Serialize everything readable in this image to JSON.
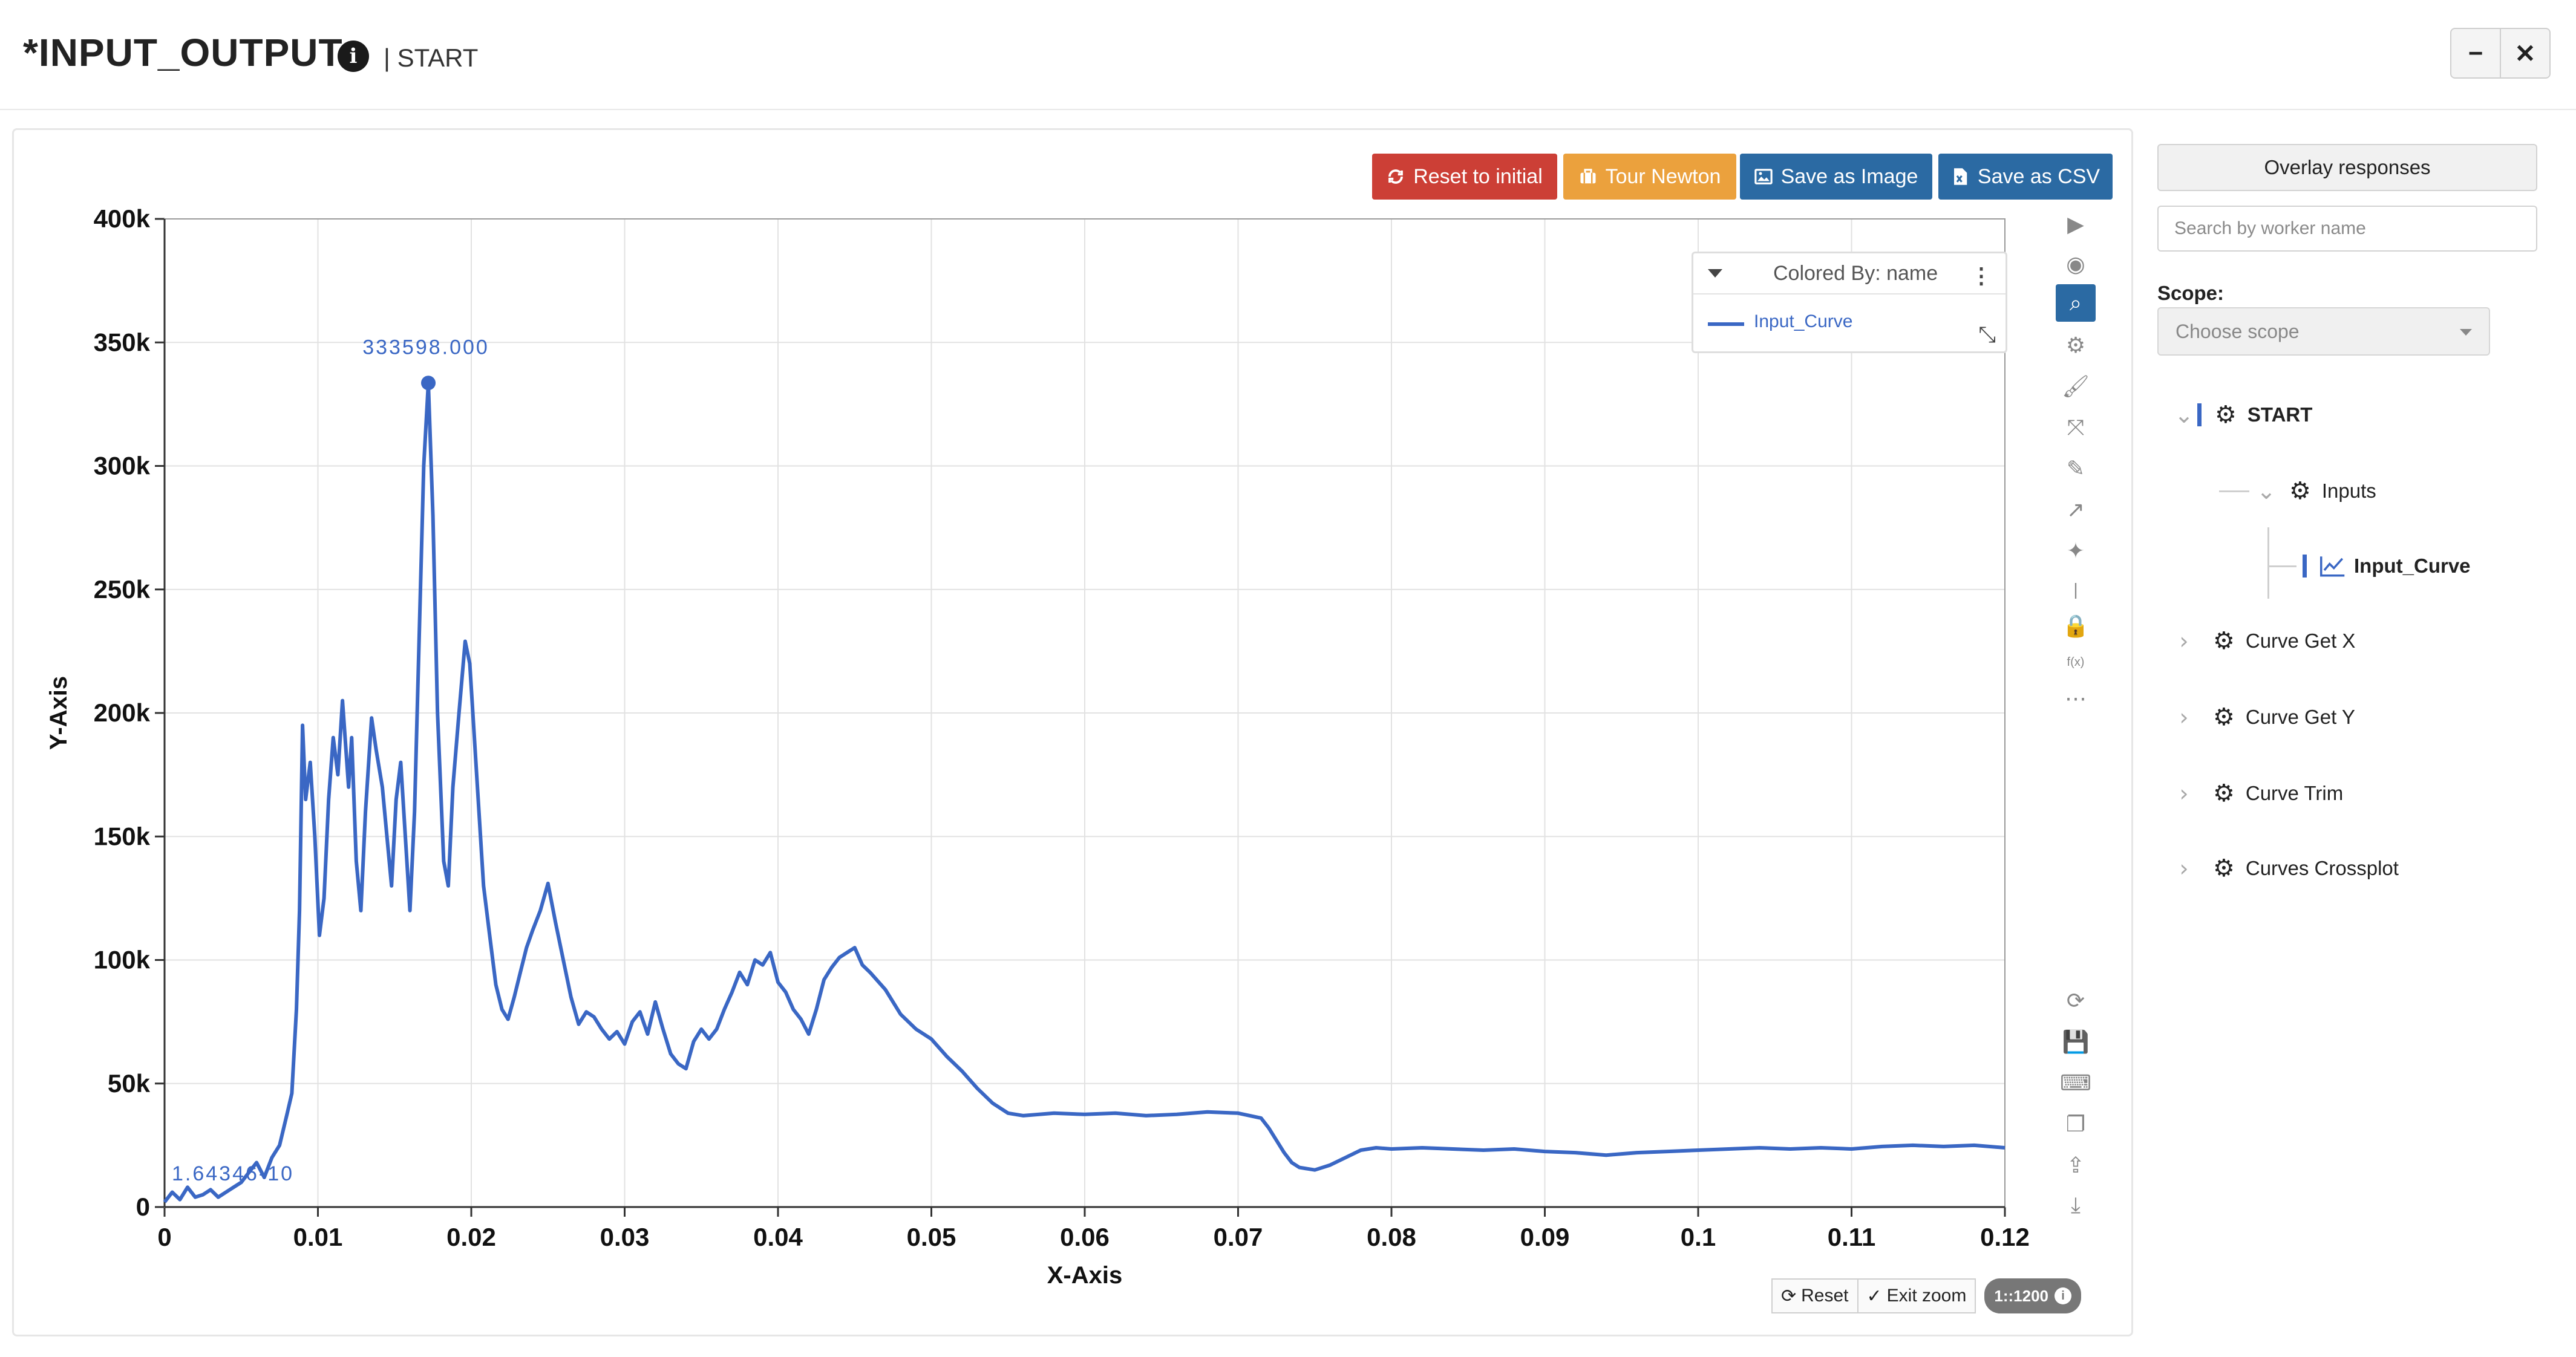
{
  "header": {
    "title": "*INPUT_OUTPUT",
    "separator_text": "| START",
    "minimize_glyph": "−",
    "close_glyph": "✕"
  },
  "toolbar": {
    "reset_initial_label": "Reset to initial",
    "tour_label": "Tour Newton",
    "save_image_label": "Save as Image",
    "save_csv_label": "Save as CSV"
  },
  "legend": {
    "title": "Colored By: name",
    "series_name": "Input_Curve",
    "series_color": "#3a67c4"
  },
  "chart_tools": [
    "play-icon",
    "eye-icon",
    "zoom-icon",
    "gear-icon",
    "brush-icon",
    "expand-icon",
    "pencil-icon",
    "arrow-icon",
    "magic-wand-icon",
    "separator-icon",
    "lock-icon",
    "function-icon",
    "more-icon",
    "refresh-icon",
    "save-icon",
    "keyboard-icon",
    "copy-icon",
    "upload-icon",
    "download-icon"
  ],
  "zoom_bar": {
    "reset_label": "Reset",
    "exit_zoom_label": "Exit zoom",
    "scale_label": "1::1200"
  },
  "sidebar": {
    "overlay_label": "Overlay responses",
    "search_placeholder": "Search by worker name",
    "scope_label": "Scope:",
    "scope_placeholder": "Choose scope",
    "tree": {
      "start": "START",
      "inputs": "Inputs",
      "input_curve": "Input_Curve",
      "curve_get_x": "Curve Get X",
      "curve_get_y": "Curve Get Y",
      "curve_trim": "Curve Trim",
      "curves_crossplot": "Curves Crossplot"
    }
  },
  "chart_data": {
    "type": "line",
    "xlabel": "X-Axis",
    "ylabel": "Y-Axis",
    "xlim": [
      0,
      0.12
    ],
    "ylim": [
      0,
      400000
    ],
    "x_ticks": [
      "0",
      "0.01",
      "0.02",
      "0.03",
      "0.04",
      "0.05",
      "0.06",
      "0.07",
      "0.08",
      "0.09",
      "0.1",
      "0.11",
      "0.12"
    ],
    "y_ticks": [
      "0",
      "50k",
      "100k",
      "150k",
      "200k",
      "250k",
      "300k",
      "350k",
      "400k"
    ],
    "grid": true,
    "legend_position": "top-right",
    "annotations": {
      "max_label": "333598.000",
      "max_point": [
        0.0172,
        333598
      ],
      "min_label": "1.64346-10"
    },
    "series": [
      {
        "name": "Input_Curve",
        "color": "#3a67c4",
        "x": [
          0,
          0.0005,
          0.001,
          0.0015,
          0.002,
          0.0025,
          0.003,
          0.0035,
          0.004,
          0.0045,
          0.005,
          0.0055,
          0.006,
          0.0065,
          0.007,
          0.0075,
          0.008,
          0.0083,
          0.0086,
          0.0088,
          0.009,
          0.0092,
          0.0095,
          0.0098,
          0.0101,
          0.0104,
          0.0107,
          0.011,
          0.0113,
          0.0116,
          0.012,
          0.0122,
          0.0125,
          0.0128,
          0.0131,
          0.0135,
          0.0138,
          0.0142,
          0.0145,
          0.0148,
          0.0151,
          0.0154,
          0.0157,
          0.016,
          0.0163,
          0.0166,
          0.0169,
          0.0172,
          0.0175,
          0.0178,
          0.0182,
          0.0185,
          0.0188,
          0.0192,
          0.0196,
          0.0199,
          0.0202,
          0.0205,
          0.0208,
          0.0212,
          0.0216,
          0.022,
          0.0224,
          0.0228,
          0.0232,
          0.0236,
          0.024,
          0.0245,
          0.025,
          0.0255,
          0.026,
          0.0265,
          0.027,
          0.0275,
          0.028,
          0.0285,
          0.029,
          0.0295,
          0.03,
          0.0305,
          0.031,
          0.0315,
          0.032,
          0.0325,
          0.033,
          0.0335,
          0.034,
          0.0345,
          0.035,
          0.0355,
          0.036,
          0.0365,
          0.037,
          0.0375,
          0.038,
          0.0385,
          0.039,
          0.0395,
          0.04,
          0.0405,
          0.041,
          0.0415,
          0.042,
          0.0425,
          0.043,
          0.0435,
          0.044,
          0.0445,
          0.045,
          0.0455,
          0.046,
          0.047,
          0.048,
          0.049,
          0.05,
          0.051,
          0.052,
          0.053,
          0.054,
          0.055,
          0.056,
          0.058,
          0.06,
          0.062,
          0.064,
          0.066,
          0.068,
          0.07,
          0.0715,
          0.072,
          0.0725,
          0.073,
          0.0735,
          0.074,
          0.075,
          0.076,
          0.077,
          0.078,
          0.079,
          0.08,
          0.082,
          0.084,
          0.086,
          0.088,
          0.09,
          0.092,
          0.094,
          0.096,
          0.098,
          0.1,
          0.102,
          0.104,
          0.106,
          0.108,
          0.11,
          0.112,
          0.114,
          0.116,
          0.118,
          0.12
        ],
        "values": [
          2000,
          6000,
          3000,
          8000,
          4000,
          5000,
          7000,
          4000,
          6000,
          8000,
          10000,
          14000,
          18000,
          12000,
          20000,
          25000,
          38000,
          46000,
          80000,
          120000,
          195000,
          165000,
          180000,
          150000,
          110000,
          125000,
          165000,
          190000,
          175000,
          205000,
          170000,
          190000,
          140000,
          120000,
          160000,
          198000,
          185000,
          170000,
          150000,
          130000,
          165000,
          180000,
          150000,
          120000,
          160000,
          230000,
          300000,
          333598,
          280000,
          200000,
          140000,
          130000,
          170000,
          200000,
          229000,
          220000,
          190000,
          160000,
          130000,
          110000,
          90000,
          80000,
          76000,
          85000,
          95000,
          105000,
          112000,
          120000,
          131000,
          115000,
          100000,
          85000,
          74000,
          79000,
          77000,
          72000,
          68000,
          71000,
          66000,
          75000,
          79000,
          70000,
          83000,
          72000,
          62000,
          58000,
          56000,
          67000,
          72000,
          68000,
          72000,
          80000,
          87000,
          95000,
          90000,
          100000,
          98000,
          103000,
          91000,
          87000,
          80000,
          76000,
          70000,
          80000,
          92000,
          97000,
          101000,
          103000,
          105000,
          98000,
          95000,
          88000,
          78000,
          72000,
          68000,
          61000,
          55000,
          48000,
          42000,
          38000,
          37000,
          38000,
          37500,
          38000,
          37000,
          37500,
          38500,
          38000,
          36000,
          32000,
          27000,
          22000,
          18000,
          16000,
          15000,
          17000,
          20000,
          23000,
          24000,
          23500,
          24000,
          23500,
          23000,
          23500,
          22500,
          22000,
          21000,
          22000,
          22500,
          23000,
          23500,
          24000,
          23500,
          24000,
          23500,
          24500,
          25000,
          24500,
          25000,
          24000
        ]
      }
    ]
  }
}
